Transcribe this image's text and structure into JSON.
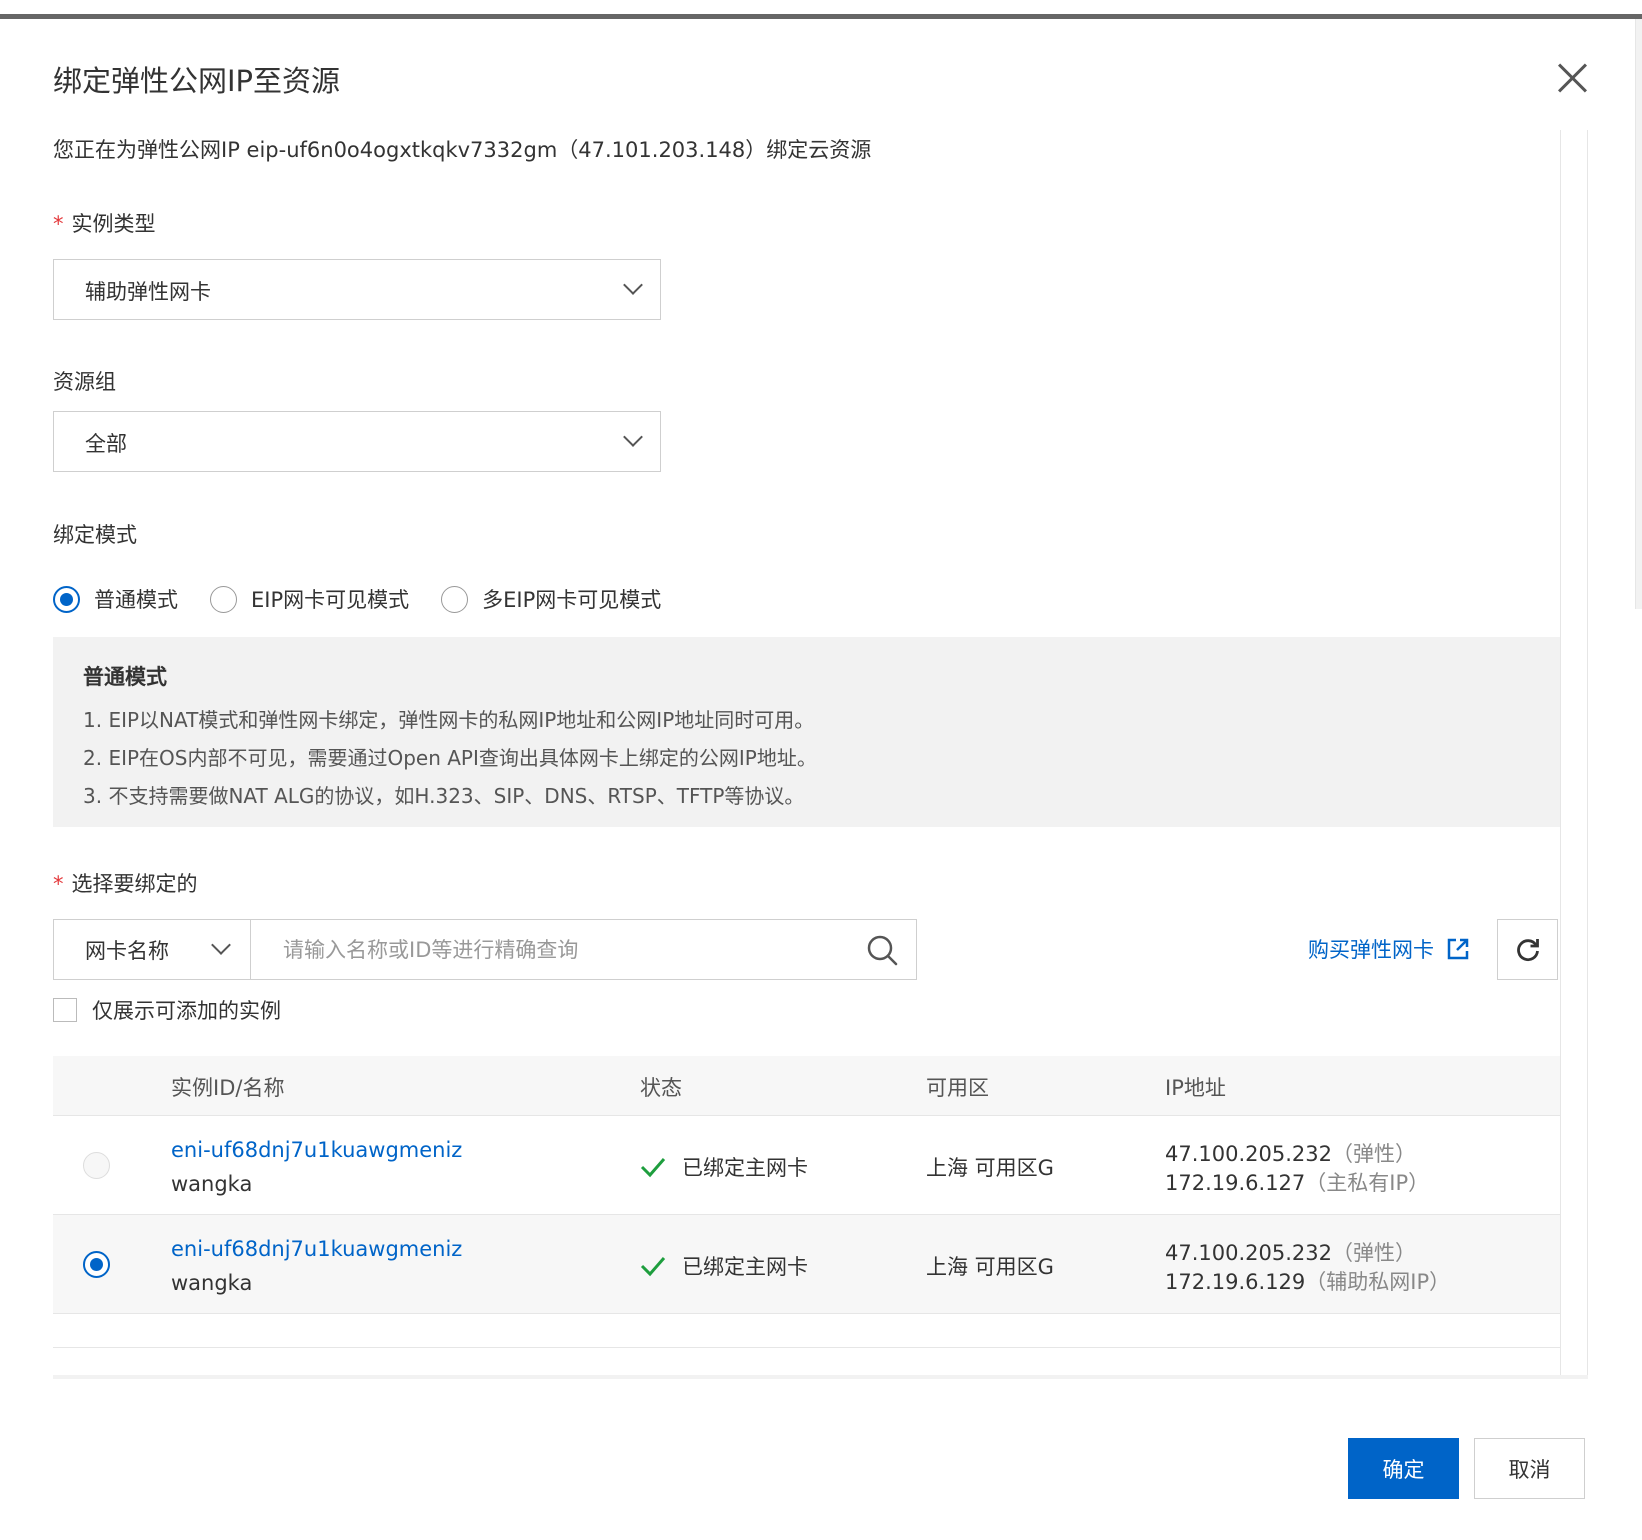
{
  "dialog": {
    "title": "绑定弹性公网IP至资源",
    "description": "您正在为弹性公网IP eip-uf6n0o4ogxtkqkv7332gm（47.101.203.148）绑定云资源"
  },
  "instance_type": {
    "required_mark": "*",
    "label": "实例类型",
    "value": "辅助弹性网卡"
  },
  "resource_group": {
    "label": "资源组",
    "value": "全部"
  },
  "bind_mode": {
    "label": "绑定模式",
    "options": [
      {
        "label": "普通模式",
        "checked": true
      },
      {
        "label": "EIP网卡可见模式",
        "checked": false
      },
      {
        "label": "多EIP网卡可见模式",
        "checked": false
      }
    ],
    "info": {
      "title": "普通模式",
      "lines": [
        "1. EIP以NAT模式和弹性网卡绑定，弹性网卡的私网IP地址和公网IP地址同时可用。",
        "2. EIP在OS内部不可见，需要通过Open API查询出具体网卡上绑定的公网IP地址。",
        "3. 不支持需要做NAT ALG的协议，如H.323、SIP、DNS、RTSP、TFTP等协议。"
      ]
    }
  },
  "select_target": {
    "required_mark": "*",
    "label": "选择要绑定的",
    "search_type": "网卡名称",
    "search_placeholder": "请输入名称或ID等进行精确查询",
    "buy_link": "购买弹性网卡",
    "only_addable_label": "仅展示可添加的实例"
  },
  "table": {
    "headers": [
      "实例ID/名称",
      "状态",
      "可用区",
      "IP地址"
    ],
    "rows": [
      {
        "id": "eni-uf68dnj7u1kuawgmeniz",
        "name": "wangka",
        "status": "已绑定主网卡",
        "zone": "上海 可用区G",
        "ip1": "47.100.205.232",
        "ip1_note": "（弹性）",
        "ip2": "172.19.6.127",
        "ip2_note": "（主私有IP）",
        "selected": false,
        "disabled": true
      },
      {
        "id": "eni-uf68dnj7u1kuawgmeniz",
        "name": "wangka",
        "status": "已绑定主网卡",
        "zone": "上海 可用区G",
        "ip1": "47.100.205.232",
        "ip1_note": "（弹性）",
        "ip2": "172.19.6.129",
        "ip2_note": "（辅助私网IP）",
        "selected": true,
        "disabled": false
      }
    ]
  },
  "footer": {
    "confirm_label": "确定",
    "cancel_label": "取消"
  },
  "colors": {
    "primary": "#0064c8",
    "required": "#e4393c",
    "success": "#1e9e3e"
  }
}
